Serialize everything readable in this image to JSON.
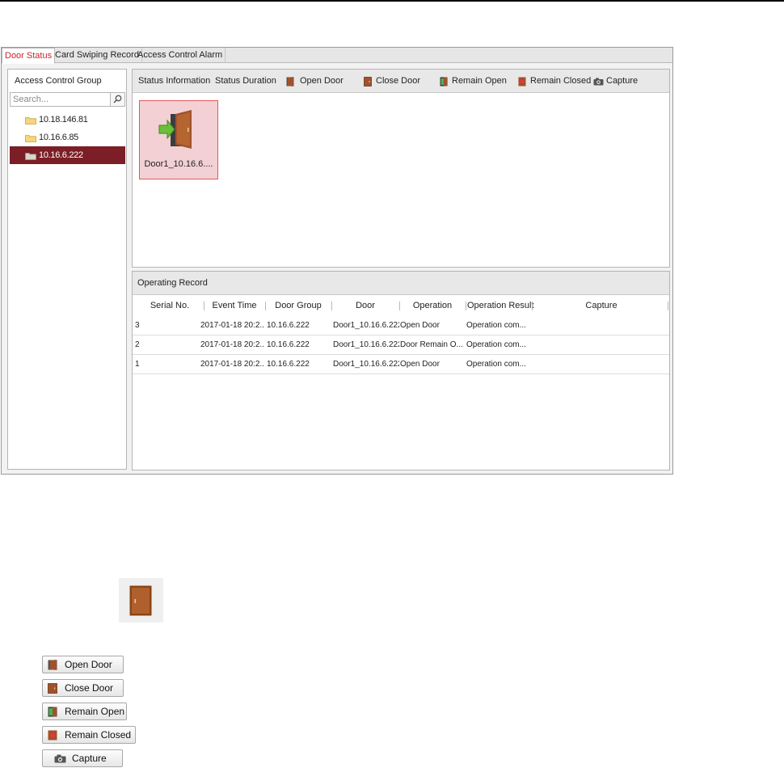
{
  "tabs": [
    {
      "label": "Door Status",
      "active": true
    },
    {
      "label": "Card Swiping Record",
      "active": false
    },
    {
      "label": "Access Control Alarm",
      "active": false
    }
  ],
  "sidebar": {
    "title": "Access Control Group",
    "search_placeholder": "Search...",
    "items": [
      {
        "label": "10.18.146.81",
        "selected": false
      },
      {
        "label": "10.16.6.85",
        "selected": false
      },
      {
        "label": "10.16.6.222",
        "selected": true
      }
    ]
  },
  "toolbar": {
    "status_information": "Status Information",
    "status_duration": "Status Duration",
    "open_door": "Open Door",
    "close_door": "Close Door",
    "remain_open": "Remain Open",
    "remain_closed": "Remain Closed",
    "capture": "Capture"
  },
  "door_card": {
    "name": "Door1_10.16.6...."
  },
  "operating_record": {
    "title": "Operating Record",
    "columns": [
      "Serial No.",
      "Event Time",
      "Door Group",
      "Door",
      "Operation",
      "Operation Result",
      "Capture"
    ],
    "rows": [
      {
        "serial": "3",
        "event_time": "2017-01-18 20:2...",
        "door_group": "10.16.6.222",
        "door": "Door1_10.16.6.222",
        "operation": "Open Door",
        "result": "Operation com...",
        "capture": ""
      },
      {
        "serial": "2",
        "event_time": "2017-01-18 20:2...",
        "door_group": "10.16.6.222",
        "door": "Door1_10.16.6.222",
        "operation": "Door Remain O...",
        "result": "Operation com...",
        "capture": ""
      },
      {
        "serial": "1",
        "event_time": "2017-01-18 20:2...",
        "door_group": "10.16.6.222",
        "door": "Door1_10.16.6.222",
        "operation": "Open Door",
        "result": "Operation com...",
        "capture": ""
      }
    ]
  },
  "legend_buttons": {
    "open_door": "Open Door",
    "close_door": "Close Door",
    "remain_open": "Remain Open",
    "remain_closed": "Remain Closed",
    "capture": "Capture"
  },
  "icons": {
    "folder": "folder-icon",
    "door_open": "door-open-icon",
    "door_closed": "door-closed-icon",
    "remain_open": "remain-open-icon",
    "remain_closed": "remain-closed-icon",
    "camera": "camera-icon"
  },
  "colors": {
    "active_tab_text": "#c8242c",
    "selected_row": "#7b1e26",
    "door_card_bg": "#f2d0d3",
    "door_card_border": "#e2595f",
    "door_brown": "#a0522d"
  }
}
